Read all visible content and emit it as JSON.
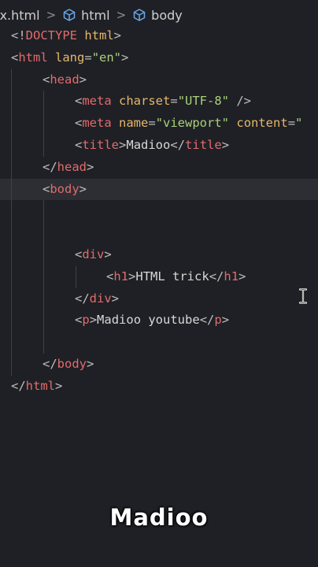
{
  "breadcrumb": {
    "file": "ex.html",
    "items": [
      "html",
      "body"
    ],
    "separator": ">"
  },
  "code": {
    "l1": {
      "lt": "<!",
      "doctype": "DOCTYPE",
      "sp": " ",
      "html": "html",
      "gt": ">"
    },
    "l2": {
      "lt": "<",
      "tag": "html",
      "sp": " ",
      "attr": "lang",
      "eq": "=",
      "val": "\"en\"",
      "gt": ">"
    },
    "l3": {
      "lt": "<",
      "tag": "head",
      "gt": ">"
    },
    "l4": {
      "lt": "<",
      "tag": "meta",
      "sp": " ",
      "attr": "charset",
      "eq": "=",
      "val": "\"UTF-8\"",
      "end": " />"
    },
    "l5": {
      "lt": "<",
      "tag": "meta",
      "sp": " ",
      "attr1": "name",
      "eq1": "=",
      "val1": "\"viewport\"",
      "sp2": " ",
      "attr2": "content",
      "eq2": "=",
      "val2": "\""
    },
    "l6": {
      "lt": "<",
      "tag": "title",
      "gt": ">",
      "text": "Madioo",
      "lt2": "</",
      "tag2": "title",
      "gt2": ">"
    },
    "l7": {
      "lt": "</",
      "tag": "head",
      "gt": ">"
    },
    "l8": {
      "lt": "<",
      "tag": "body",
      "gt": ">"
    },
    "l11": {
      "lt": "<",
      "tag": "div",
      "gt": ">"
    },
    "l12": {
      "lt": "<",
      "tag": "h1",
      "gt": ">",
      "text": "HTML trick",
      "lt2": "</",
      "tag2": "h1",
      "gt2": ">"
    },
    "l13": {
      "lt": "</",
      "tag": "div",
      "gt": ">"
    },
    "l14": {
      "lt": "<",
      "tag": "p",
      "gt": ">",
      "text": "Madioo youtube",
      "lt2": "</",
      "tag2": "p",
      "gt2": ">"
    },
    "l16": {
      "lt": "</",
      "tag": "body",
      "gt": ">"
    },
    "l17": {
      "lt": "</",
      "tag": "html",
      "gt": ">"
    }
  },
  "watermark": "Madioo",
  "icons": {
    "breadcrumb_item": "cube-icon",
    "cursor": "text-cursor-icon"
  }
}
